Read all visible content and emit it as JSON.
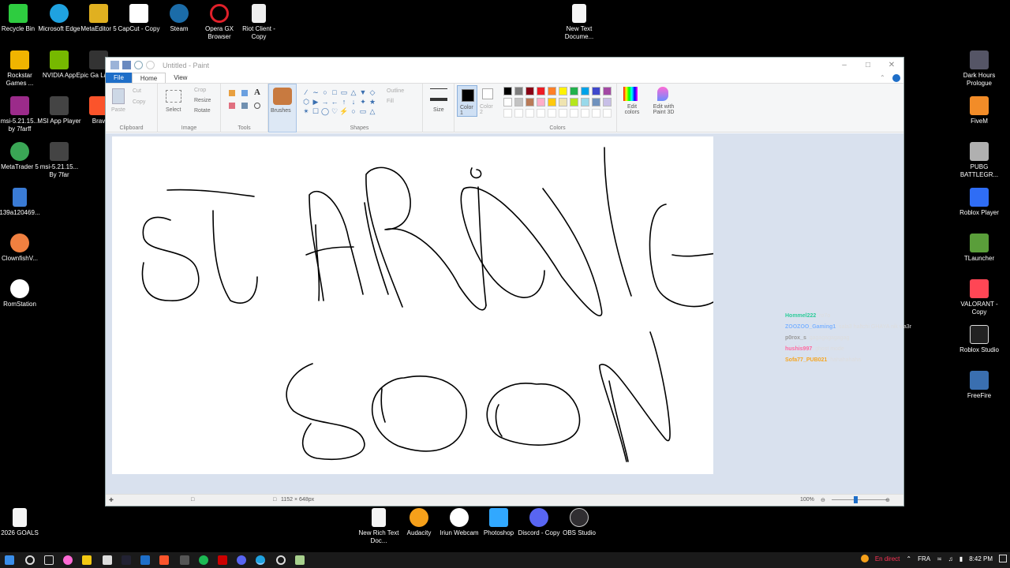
{
  "desktop_icons": [
    {
      "label": "Recycle Bin",
      "icon": "recycle-bin-icon",
      "color": "#2ecc40"
    },
    {
      "label": "Microsoft Edge",
      "icon": "edge-icon",
      "color": "#1fa2e0"
    },
    {
      "label": "MetaEditor 5",
      "icon": "metaeditor-icon",
      "color": "#e0b020"
    },
    {
      "label": "CapCut - Copy",
      "icon": "capcut-icon",
      "color": "#ffffff"
    },
    {
      "label": "Steam",
      "icon": "steam-icon",
      "color": "#1b6ca8"
    },
    {
      "label": "Opera GX Browser",
      "icon": "opera-gx-icon",
      "color": "#e0202a"
    },
    {
      "label": "Riot Client - Copy",
      "icon": "riot-client-icon",
      "color": "#eeeeee"
    },
    {
      "label": "New Text Docume...",
      "icon": "text-document-icon",
      "color": "#f5f5f5"
    },
    {
      "label": "Rockstar Games ...",
      "icon": "rockstar-icon",
      "color": "#f0b400"
    },
    {
      "label": "NVIDIA App",
      "icon": "nvidia-icon",
      "color": "#76b900"
    },
    {
      "label": "Epic Ga Launch",
      "icon": "epic-games-icon",
      "color": "#333333"
    },
    {
      "label": "msi-5.21.15... by 7farff",
      "icon": "winrar-icon",
      "color": "#9b2b8a"
    },
    {
      "label": "MSI App Player",
      "icon": "msi-player-icon",
      "color": "#444444"
    },
    {
      "label": "Brav",
      "icon": "brave-icon",
      "color": "#fb542b"
    },
    {
      "label": "MetaTrader 5",
      "icon": "metatrader-icon",
      "color": "#3aa655"
    },
    {
      "label": "msi-5.21.15... By 7far",
      "icon": "msi-player-icon",
      "color": "#444444"
    },
    {
      "label": "139a120469...",
      "icon": "image-file-icon",
      "color": "#3a7bd5"
    },
    {
      "label": "ClownfishV...",
      "icon": "clownfish-icon",
      "color": "#f08040"
    },
    {
      "label": "RomStation",
      "icon": "romstation-icon",
      "color": "#ffffff"
    },
    {
      "label": "2026 GOALS",
      "icon": "text-document-icon",
      "color": "#f5f5f5"
    },
    {
      "label": "Dark Hours Prologue",
      "icon": "dark-hours-icon",
      "color": "#556"
    },
    {
      "label": "FiveM",
      "icon": "fivem-icon",
      "color": "#f28c28"
    },
    {
      "label": "PUBG BATTLEGR...",
      "icon": "pubg-icon",
      "color": "#b0b0b0"
    },
    {
      "label": "Roblox Player",
      "icon": "roblox-icon",
      "color": "#2f6df5"
    },
    {
      "label": "TLauncher",
      "icon": "tlauncher-icon",
      "color": "#5a9e3a"
    },
    {
      "label": "VALORANT - Copy",
      "icon": "valorant-icon",
      "color": "#ff4655"
    },
    {
      "label": "Roblox Studio",
      "icon": "roblox-studio-icon",
      "color": "#222"
    },
    {
      "label": "FreeFire",
      "icon": "freefire-icon",
      "color": "#3a6fb0"
    },
    {
      "label": "New Rich Text Doc...",
      "icon": "rich-text-icon",
      "color": "#f5f5f5"
    },
    {
      "label": "Audacity",
      "icon": "audacity-icon",
      "color": "#f6a01a"
    },
    {
      "label": "Iriun Webcam",
      "icon": "iriun-webcam-icon",
      "color": "#ffffff"
    },
    {
      "label": "Photoshop",
      "icon": "photoshop-icon",
      "color": "#31a8ff"
    },
    {
      "label": "Discord - Copy",
      "icon": "discord-icon",
      "color": "#5865f2"
    },
    {
      "label": "OBS Studio",
      "icon": "obs-icon",
      "color": "#302e31"
    }
  ],
  "paint": {
    "title": "Untitled - Paint",
    "menu": {
      "file": "File",
      "home": "Home",
      "view": "View"
    },
    "clipboard": {
      "paste": "Paste",
      "cut": "Cut",
      "copy": "Copy",
      "group": "Clipboard"
    },
    "image": {
      "select": "Select",
      "crop": "Crop",
      "resize": "Resize",
      "rotate": "Rotate",
      "group": "Image"
    },
    "tools": {
      "group": "Tools"
    },
    "brushes": {
      "label": "Brushes"
    },
    "shapes": {
      "outline": "Outline",
      "fill": "Fill",
      "group": "Shapes"
    },
    "size": {
      "label": "Size"
    },
    "color1": {
      "label": "Color 1"
    },
    "color2": {
      "label": "Color 2"
    },
    "colors_group": "Colors",
    "edit_colors": "Edit colors",
    "paint3d": "Edit with Paint 3D",
    "palette": [
      "#000000",
      "#7f7f7f",
      "#880015",
      "#ed1c24",
      "#ff7f27",
      "#fff200",
      "#22b14c",
      "#00a2e8",
      "#3f48cc",
      "#a349a4",
      "#ffffff",
      "#c3c3c3",
      "#b97a57",
      "#ffaec9",
      "#ffc90e",
      "#efe4b0",
      "#b5e61d",
      "#99d9ea",
      "#7092be",
      "#c8bfe7"
    ],
    "status": {
      "dimensions": "1152 × 648px",
      "zoom": "100%"
    }
  },
  "chat": [
    {
      "user": "Hommel222",
      "msg": ": ro7o",
      "color": "#2ecc9a"
    },
    {
      "user": "ZOOZOO_Gaming1",
      "msg": ": sala3 haltchi GHAYA nik wa3r",
      "color": "#7fb4ff"
    },
    {
      "user": "p0rox_s",
      "msg": ": gagagagagagag",
      "color": "#999999"
    },
    {
      "user": "hushis997",
      "msg": ": ghost mode",
      "color": "#ff6aa0"
    },
    {
      "user": "Sofa77_PUB021",
      "msg": ": hahahahaha",
      "color": "#f5a623"
    }
  ],
  "taskbar": {
    "live": "En direct",
    "lang": "FRA",
    "time": "8:42 PM"
  }
}
